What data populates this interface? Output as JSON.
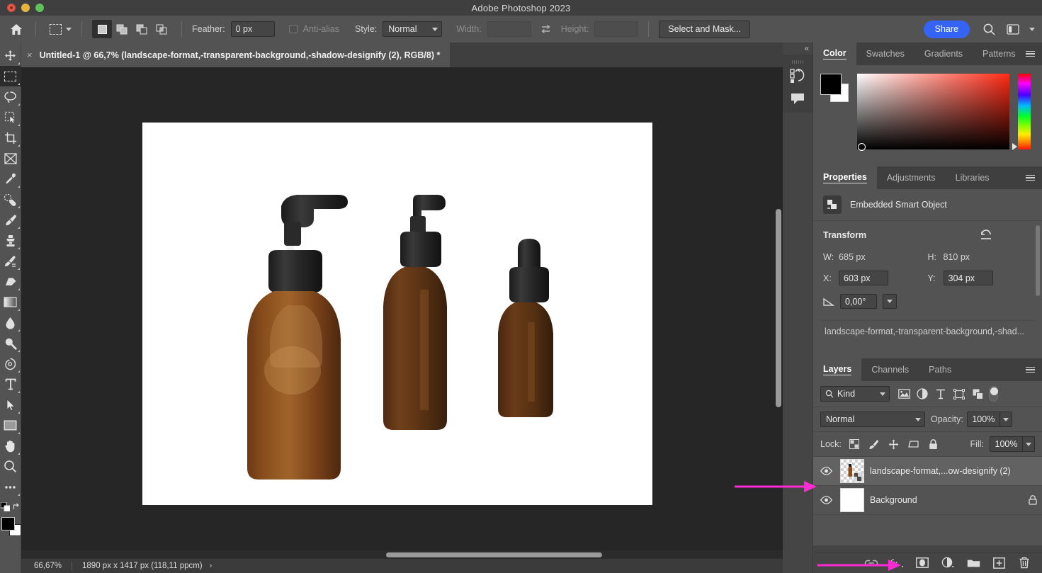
{
  "window": {
    "title": "Adobe Photoshop 2023",
    "controls": [
      "close",
      "minimize",
      "maximize"
    ]
  },
  "options_bar": {
    "home_icon": "home-icon",
    "tool_icon": "rectangular-marquee-icon",
    "selection_modes": [
      "new-selection",
      "add-to-selection",
      "subtract-from-selection",
      "intersect-with-selection"
    ],
    "feather_label": "Feather:",
    "feather_value": "0 px",
    "antialias_label": "Anti-alias",
    "antialias_checked": false,
    "style_label": "Style:",
    "style_value": "Normal",
    "width_label": "Width:",
    "width_value": "",
    "swap_icon": "swap-dimensions-icon",
    "height_label": "Height:",
    "height_value": "",
    "select_and_mask_label": "Select and Mask...",
    "share_label": "Share",
    "search_icon": "search-icon",
    "workspace_icon": "workspace-layout-icon",
    "workspace_caret": "chevron-down-icon",
    "accent_color": "#3563f3"
  },
  "toolbar": {
    "tools": [
      {
        "name": "move-tool",
        "active": false
      },
      {
        "name": "rectangular-marquee-tool",
        "active": true
      },
      {
        "name": "lasso-tool",
        "active": false
      },
      {
        "name": "object-selection-tool",
        "active": false
      },
      {
        "name": "crop-tool",
        "active": false
      },
      {
        "name": "frame-tool",
        "active": false
      },
      {
        "name": "eyedropper-tool",
        "active": false
      },
      {
        "name": "spot-healing-brush-tool",
        "active": false
      },
      {
        "name": "brush-tool",
        "active": false
      },
      {
        "name": "clone-stamp-tool",
        "active": false
      },
      {
        "name": "history-brush-tool",
        "active": false
      },
      {
        "name": "eraser-tool",
        "active": false
      },
      {
        "name": "gradient-tool",
        "active": false
      },
      {
        "name": "blur-tool",
        "active": false
      },
      {
        "name": "dodge-tool",
        "active": false
      },
      {
        "name": "pen-tool",
        "active": false
      },
      {
        "name": "type-tool",
        "active": false
      },
      {
        "name": "path-selection-tool",
        "active": false
      },
      {
        "name": "rectangle-tool",
        "active": false
      },
      {
        "name": "hand-tool",
        "active": false
      },
      {
        "name": "zoom-tool",
        "active": false
      },
      {
        "name": "edit-toolbar-tool",
        "active": false
      }
    ],
    "foreground_color": "#000000",
    "background_color": "#ffffff"
  },
  "document_tab": {
    "close_glyph": "×",
    "title": "Untitled-1 @ 66,7% (landscape-format,-transparent-background,-shadow-designify (2), RGB/8) *"
  },
  "canvas": {
    "background_color": "#262626",
    "artboard_color": "#ffffff",
    "content_description": "three amber glass bottles on white background",
    "objects": [
      {
        "name": "tall-pump-bottle"
      },
      {
        "name": "medium-pump-bottle"
      },
      {
        "name": "small-dropper-bottle"
      }
    ]
  },
  "status_bar": {
    "zoom": "66,67%",
    "dimensions": "1890 px x 1417 px (118,11 ppcm)",
    "expand_glyph": "›"
  },
  "icon_dock": {
    "collapse_glyph": "«",
    "buttons": [
      {
        "name": "history-panel-icon"
      },
      {
        "name": "comments-panel-icon"
      }
    ]
  },
  "color_panel": {
    "tabs": [
      {
        "label": "Color",
        "active": true
      },
      {
        "label": "Swatches",
        "active": false
      },
      {
        "label": "Gradients",
        "active": false
      },
      {
        "label": "Patterns",
        "active": false
      }
    ],
    "menu_icon": "panel-menu-icon",
    "foreground": "#000000",
    "background": "#ffffff",
    "hue_base": "#ff2a14"
  },
  "properties_panel": {
    "tabs": [
      {
        "label": "Properties",
        "active": true
      },
      {
        "label": "Adjustments",
        "active": false
      },
      {
        "label": "Libraries",
        "active": false
      }
    ],
    "menu_icon": "panel-menu-icon",
    "object_type_icon": "smart-object-icon",
    "object_type": "Embedded Smart Object",
    "transform_title": "Transform",
    "reset_icon": "reset-transform-icon",
    "w_label": "W:",
    "w_value": "685 px",
    "h_label": "H:",
    "h_value": "810 px",
    "x_label": "X:",
    "x_value": "603 px",
    "y_label": "Y:",
    "y_value": "304 px",
    "angle_icon": "angle-icon",
    "angle_value": "0,00°",
    "layer_name": "landscape-format,-transparent-background,-shad..."
  },
  "layers_panel": {
    "tabs": [
      {
        "label": "Layers",
        "active": true
      },
      {
        "label": "Channels",
        "active": false
      },
      {
        "label": "Paths",
        "active": false
      }
    ],
    "menu_icon": "panel-menu-icon",
    "filter": {
      "search_icon": "search-icon",
      "kind_label": "Kind",
      "caret_icon": "chevron-down-icon",
      "type_filters": [
        {
          "name": "filter-pixel-layers-icon"
        },
        {
          "name": "filter-adjustment-layers-icon"
        },
        {
          "name": "filter-type-layers-icon"
        },
        {
          "name": "filter-shape-layers-icon"
        },
        {
          "name": "filter-smart-object-layers-icon"
        }
      ],
      "toggle_name": "filter-toggle-switch",
      "toggle_on": false
    },
    "blend_mode": "Normal",
    "opacity_label": "Opacity:",
    "opacity_value": "100%",
    "lock_label": "Lock:",
    "lock_buttons": [
      {
        "name": "lock-transparent-pixels-icon"
      },
      {
        "name": "lock-image-pixels-icon"
      },
      {
        "name": "lock-position-icon"
      },
      {
        "name": "lock-artboard-nesting-icon"
      },
      {
        "name": "lock-all-icon"
      }
    ],
    "fill_label": "Fill:",
    "fill_value": "100%",
    "layers": [
      {
        "name": "landscape-format,...ow-designify (2)",
        "visible": true,
        "selected": true,
        "thumbnail": "transparent-bottle-thumbnail",
        "smart_object": true,
        "locked": false
      },
      {
        "name": "Background",
        "visible": true,
        "selected": false,
        "thumbnail": "white-thumbnail",
        "smart_object": false,
        "locked": true
      }
    ],
    "bottom_buttons": [
      {
        "name": "link-layers-icon",
        "label": ""
      },
      {
        "name": "layer-style-fx-icon",
        "label": "fx"
      },
      {
        "name": "add-layer-mask-icon",
        "label": ""
      },
      {
        "name": "new-fill-adjustment-layer-icon",
        "label": ""
      },
      {
        "name": "new-group-icon",
        "label": ""
      },
      {
        "name": "new-layer-icon",
        "label": ""
      },
      {
        "name": "delete-layer-icon",
        "label": ""
      }
    ]
  },
  "annotations": {
    "arrow_color": "#ff2ad4",
    "arrows": [
      {
        "name": "arrow-to-layer-visibility",
        "target": "layer-eye-icon"
      },
      {
        "name": "arrow-to-layer-style-button",
        "target": "layer-style-fx-icon"
      }
    ]
  }
}
